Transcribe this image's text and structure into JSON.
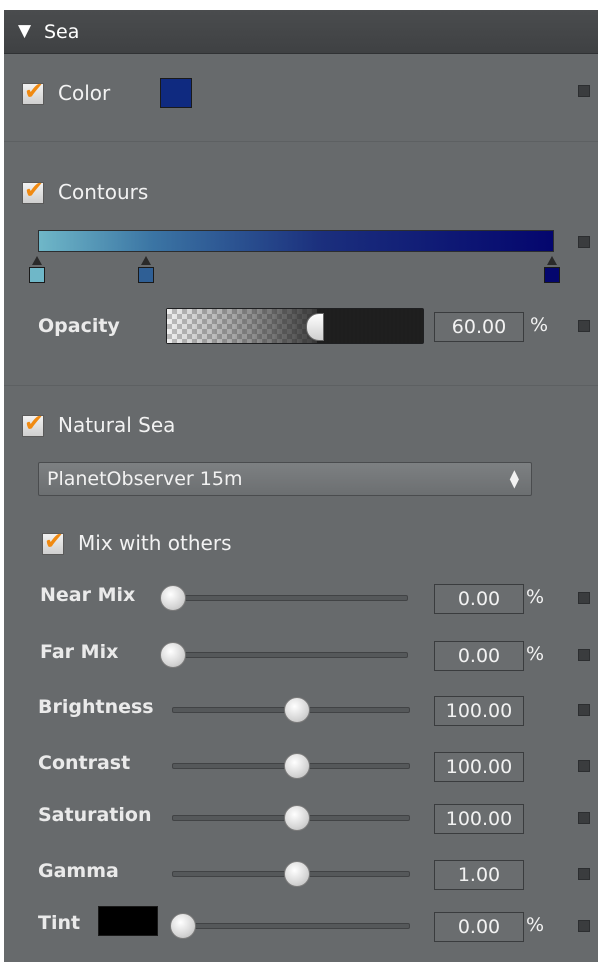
{
  "section": {
    "title": "Sea"
  },
  "color": {
    "label": "Color",
    "checked": true,
    "swatch": "#0f2a80"
  },
  "contours": {
    "label": "Contours",
    "checked": true,
    "stops": [
      "#6fb7c8",
      "#2f5f95",
      "#04066e"
    ],
    "opacity_label": "Opacity",
    "opacity_value": "60.00",
    "opacity_unit": "%",
    "opacity_fraction": 0.6
  },
  "natural_sea": {
    "label": "Natural Sea",
    "checked": true,
    "source_selected": "PlanetObserver 15m",
    "mix_label": "Mix with others",
    "mix_checked": true
  },
  "sliders": [
    {
      "label": "Near Mix",
      "value": "0.00",
      "unit": "%",
      "fraction": 0.0
    },
    {
      "label": "Far Mix",
      "value": "0.00",
      "unit": "%",
      "fraction": 0.0
    },
    {
      "label": "Brightness",
      "value": "100.00",
      "unit": "",
      "fraction": 0.5
    },
    {
      "label": "Contrast",
      "value": "100.00",
      "unit": "",
      "fraction": 0.5
    },
    {
      "label": "Saturation",
      "value": "100.00",
      "unit": "",
      "fraction": 0.5
    },
    {
      "label": "Gamma",
      "value": "1.00",
      "unit": "",
      "fraction": 0.5
    },
    {
      "label": "Tint",
      "value": "0.00",
      "unit": "%",
      "fraction": 0.0
    }
  ],
  "tint_swatch": "#000000"
}
